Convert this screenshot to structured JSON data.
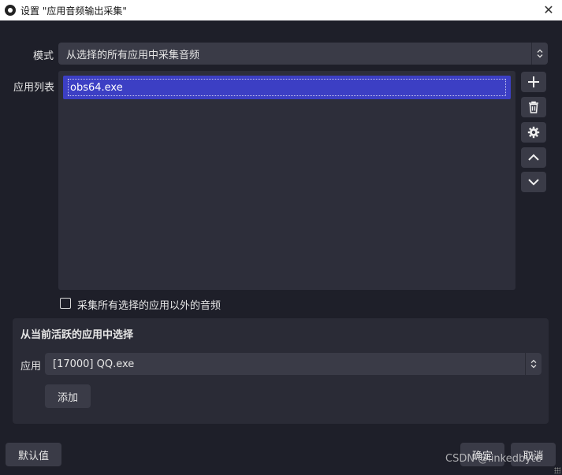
{
  "window": {
    "title": "设置 \"应用音频输出采集\"",
    "close_icon": "close-icon"
  },
  "form": {
    "mode_label": "模式",
    "mode_value": "从选择的所有应用中采集音频",
    "app_list_label": "应用列表",
    "app_list_items": [
      "obs64.exe"
    ],
    "exclude_checkbox_label": "采集所有选择的应用以外的音频",
    "exclude_checked": false
  },
  "side_buttons": [
    "add-icon",
    "trash-icon",
    "gear-icon",
    "chevron-up-icon",
    "chevron-down-icon"
  ],
  "active_apps": {
    "heading": "从当前活跃的应用中选择",
    "app_label": "应用",
    "app_value": "[17000] QQ.exe",
    "add_button": "添加"
  },
  "footer": {
    "defaults_button": "默认值",
    "ok_button": "确定",
    "cancel_button": "取消"
  },
  "watermark": "CSDN @linkedbyte",
  "colors": {
    "background": "#1e1f29",
    "selection": "#3c3fc4",
    "control": "#3a3b47"
  }
}
